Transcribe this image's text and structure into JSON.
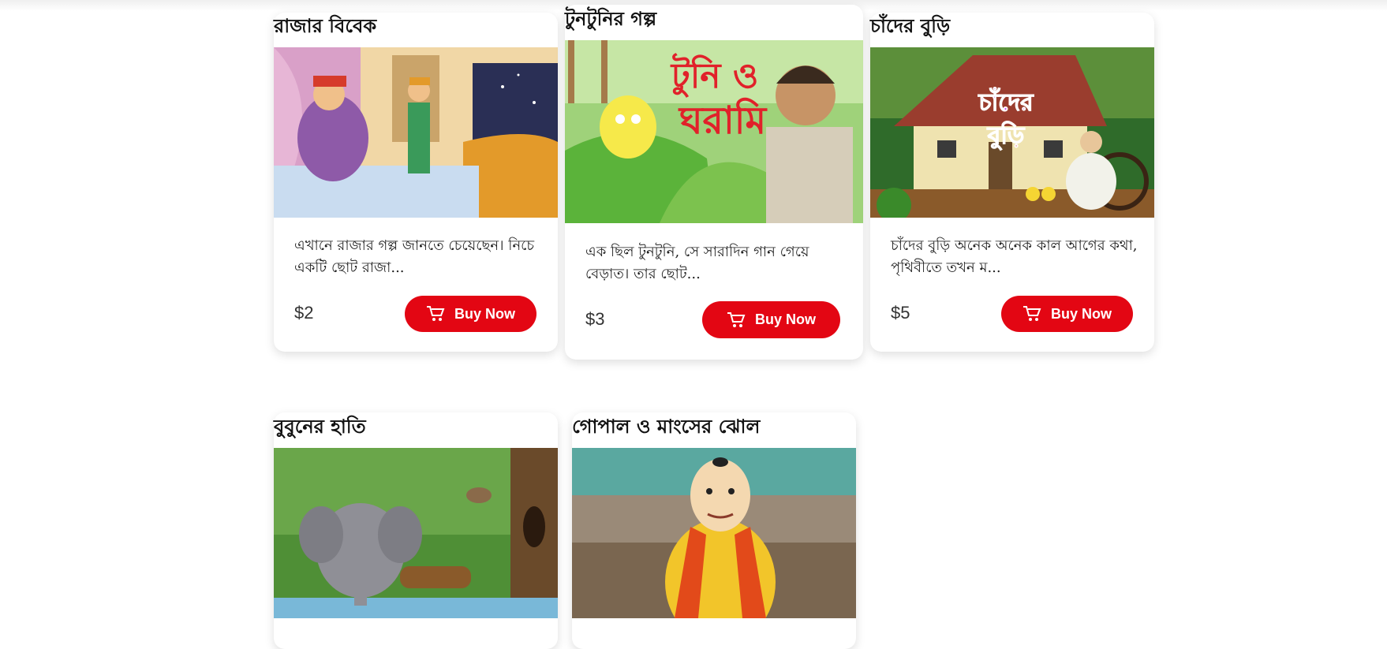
{
  "colors": {
    "accent": "#e30613",
    "card_bg": "#ffffff",
    "title": "#121212"
  },
  "products": [
    {
      "title": "রাজার বিবেক",
      "description": "এখানে রাজার গল্প জানতে চেয়েছেন। নিচে একটি ছোট রাজা...",
      "price": "$2",
      "button_label": "Buy Now",
      "button_icon": "cart-icon"
    },
    {
      "title": "টুনটুনির গল্প",
      "image_text": [
        "টুনি ও",
        "ঘরামি"
      ],
      "description": "এক ছিল টুনটুনি, সে সারাদিন গান গেয়ে বেড়াত। তার ছোট...",
      "price": "$3",
      "button_label": "Buy Now",
      "button_icon": "cart-icon"
    },
    {
      "title": "চাঁদের বুড়ি",
      "image_text": [
        "চাঁদের",
        "বুড়ি"
      ],
      "description": "চাঁদের বুড়ি অনেক অনেক কাল আগের কথা, পৃথিবীতে তখন ম...",
      "price": "$5",
      "button_label": "Buy Now",
      "button_icon": "cart-icon"
    },
    {
      "title": "বুবুনের হাতি"
    },
    {
      "title": "গোপাল ও মাংসের ঝোল"
    }
  ]
}
